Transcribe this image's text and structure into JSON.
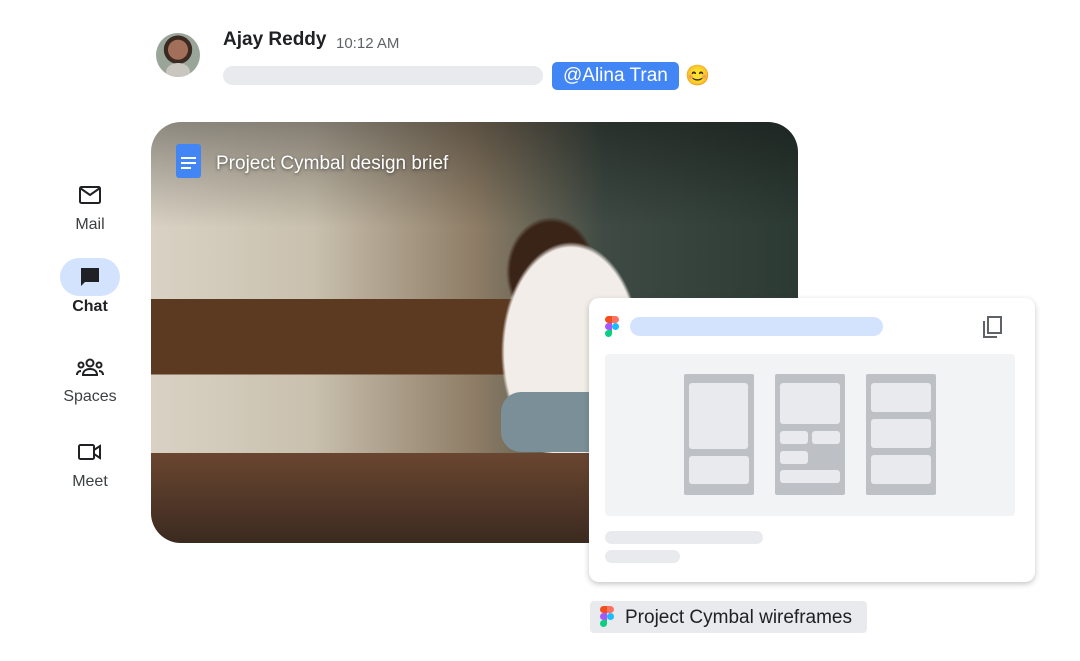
{
  "nav": [
    {
      "label": "Mail",
      "icon": "mail-icon"
    },
    {
      "label": "Chat",
      "icon": "chat-icon",
      "active": true
    },
    {
      "label": "Spaces",
      "icon": "spaces-icon"
    },
    {
      "label": "Meet",
      "icon": "video-icon"
    }
  ],
  "message": {
    "sender": "Ajay Reddy",
    "time": "10:12 AM",
    "mention": "@Alina Tran",
    "emoji": "😊"
  },
  "attachment": {
    "doc_title": "Project Cymbal design brief"
  },
  "figma_chip": {
    "label": "Project Cymbal wireframes"
  },
  "colors": {
    "accent": "#4285f4",
    "active_nav": "#d3e3fd"
  }
}
